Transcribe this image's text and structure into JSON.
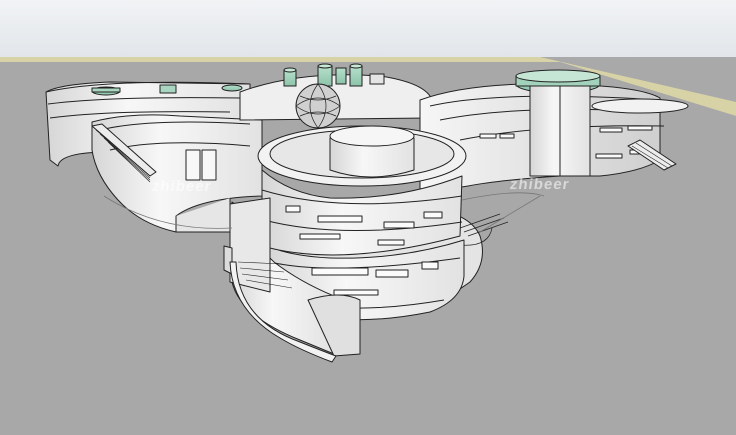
{
  "viewport": {
    "description_colors": {
      "sky": "#e8ecef",
      "horizon": "#d9d4a8",
      "ground": "#a9a9a9",
      "wall": "#f4f4f4",
      "wall_shade": "#dcdcdc",
      "wall_dark": "#c9c9c9",
      "glass": "#9fcfb9",
      "edge": "#222222"
    }
  },
  "watermarks": {
    "left": "zhibeer",
    "right": "zhibeer"
  }
}
